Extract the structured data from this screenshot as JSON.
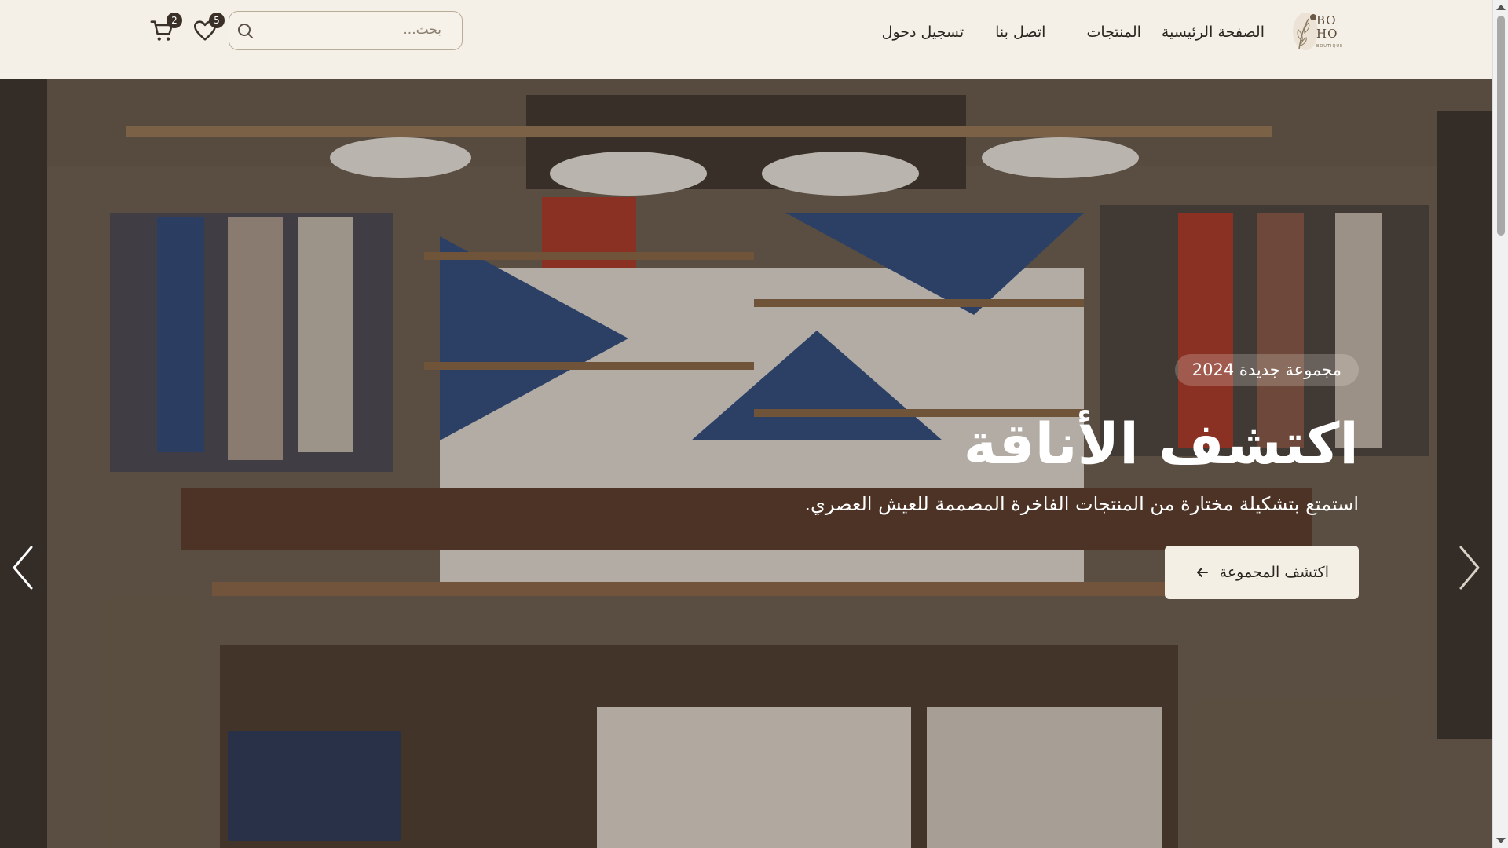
{
  "brand": {
    "logo_text_top": "BO",
    "logo_text_bottom": "HO",
    "logo_sub": "BOUTIQUE"
  },
  "nav": {
    "items": [
      {
        "label": "الصفحة الرئيسية"
      },
      {
        "label": "المنتجات"
      },
      {
        "label": "اتصل بنا"
      },
      {
        "label": "تسجيل دحول"
      }
    ]
  },
  "search": {
    "placeholder": "بحث...",
    "value": ""
  },
  "wishlist": {
    "count": "5"
  },
  "cart": {
    "count": "2"
  },
  "hero": {
    "tag": "مجموعة جديدة 2024",
    "title": "اكتشف الأناقة",
    "subtitle": "استمتع بتشكيلة مختارة من المنتجات الفاخرة المصممة للعيش العصري.",
    "cta_label": "اكتشف المجموعة",
    "cta_icon": "arrow-left-icon",
    "prev_icon": "chevron-left-icon",
    "next_icon": "chevron-right-icon",
    "background": "store-interior-photo"
  },
  "colors": {
    "header_bg": "#f4f0e7",
    "accent": "#3a3028",
    "cta_bg": "#f4efe5"
  }
}
